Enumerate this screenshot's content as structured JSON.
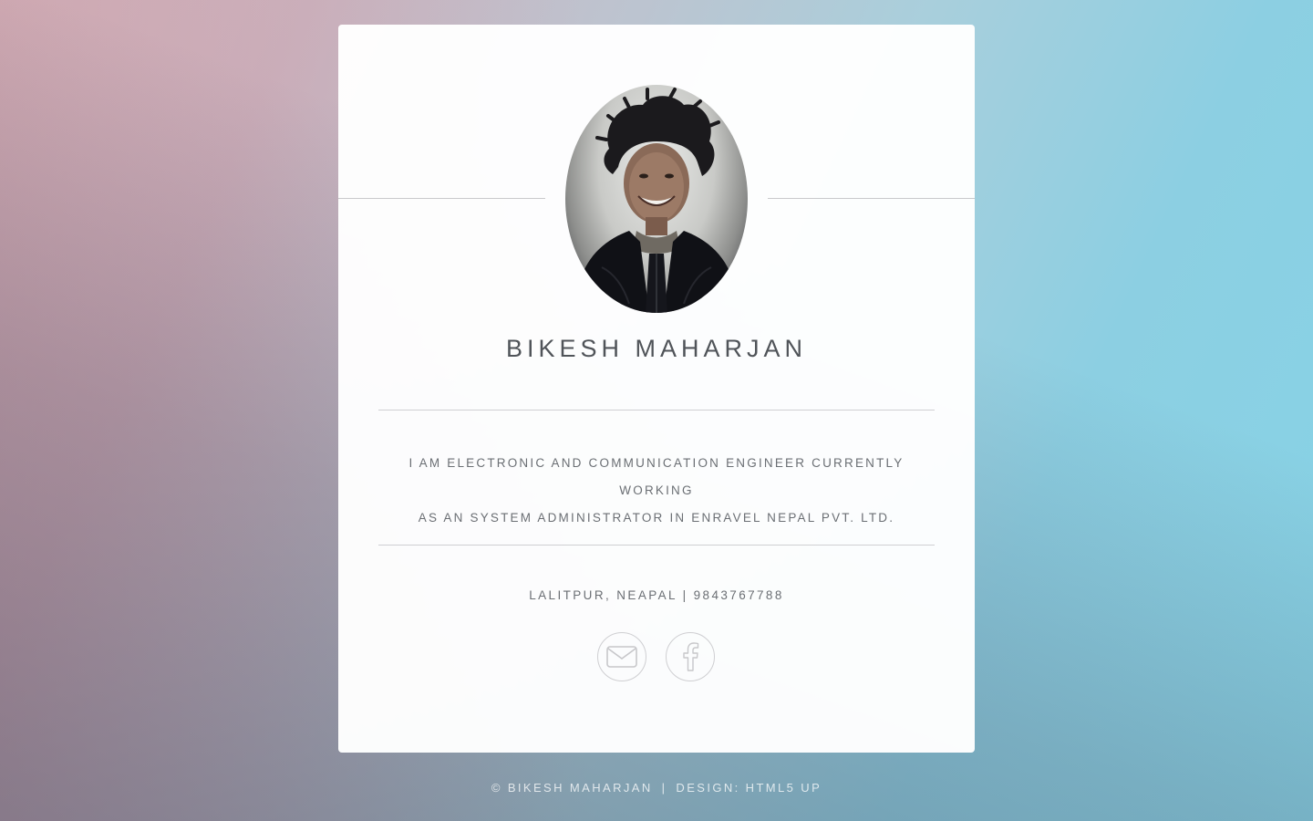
{
  "profile": {
    "name": "BIKESH MAHARJAN",
    "bio_line1": "I AM ELECTRONIC AND COMMUNICATION ENGINEER CURRENTLY WORKING",
    "bio_line2": "AS AN SYSTEM ADMINISTRATOR IN ENRAVEL NEPAL PVT. LTD.",
    "contact": "LALITPUR, NEAPAL | 9843767788"
  },
  "social": [
    {
      "name": "email",
      "icon": "envelope-icon"
    },
    {
      "name": "facebook",
      "icon": "facebook-icon"
    }
  ],
  "footer": {
    "copyright": "© BIKESH MAHARJAN",
    "separator": "|",
    "design": "DESIGN: HTML5 UP"
  },
  "colors": {
    "card": "#ffffff",
    "text": "#505459",
    "muted": "#6b6f74",
    "line": "#cfcfd2"
  }
}
